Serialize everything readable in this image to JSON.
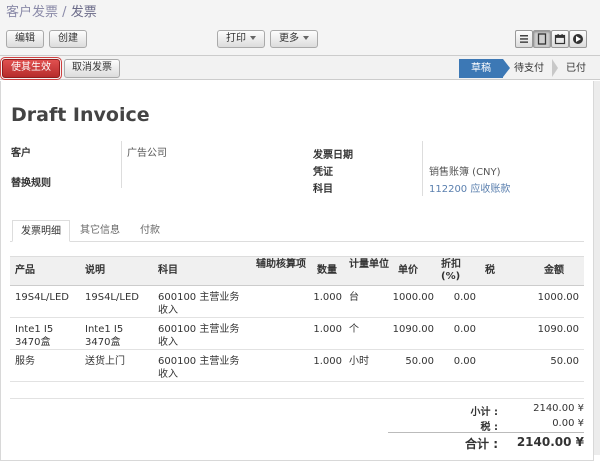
{
  "breadcrumb": {
    "parent": "客户发票",
    "separator": "/",
    "current": "发票"
  },
  "toolbar": {
    "edit": "编辑",
    "create": "创建",
    "print": "打印",
    "more": "更多"
  },
  "statusbar": {
    "validate": "使其生效",
    "cancel": "取消发票",
    "stages": [
      {
        "label": "草稿",
        "active": true
      },
      {
        "label": "待支付",
        "active": false
      },
      {
        "label": "已付",
        "active": false
      }
    ]
  },
  "invoice": {
    "title": "Draft Invoice",
    "customer_label": "客户",
    "customer_value": "广告公司",
    "fiscal_label": "替换规则",
    "date_label": "发票日期",
    "journal_label": "凭证",
    "journal_value": "销售账簿 (CNY)",
    "account_label": "科目",
    "account_value": "112200 应收账款"
  },
  "tabs": [
    "发票明细",
    "其它信息",
    "付款"
  ],
  "lines": {
    "columns": [
      "产品",
      "说明",
      "科目",
      "辅助核算项",
      "数量",
      "计量单位",
      "单价",
      "折扣(%)",
      "税",
      "金额"
    ],
    "rows": [
      {
        "product": "19S4L/LED",
        "desc": "19S4L/LED",
        "account": "600100 主营业务收入",
        "analytic": "",
        "qty": "1.000",
        "uom": "台",
        "price": "1000.00",
        "discount": "0.00",
        "tax": "",
        "amount": "1000.00"
      },
      {
        "product": "Inte1 I5 3470盒",
        "desc": "Inte1 I5 3470盒",
        "account": "600100 主营业务收入",
        "analytic": "",
        "qty": "1.000",
        "uom": "个",
        "price": "1090.00",
        "discount": "0.00",
        "tax": "",
        "amount": "1090.00"
      },
      {
        "product": "服务",
        "desc": "送货上门",
        "account": "600100 主营业务收入",
        "analytic": "",
        "qty": "1.000",
        "uom": "小时",
        "price": "50.00",
        "discount": "0.00",
        "tax": "",
        "amount": "50.00"
      }
    ]
  },
  "totals": {
    "subtotal_label": "小计 :",
    "subtotal": "2140.00 ¥",
    "tax_label": "税 :",
    "tax": "0.00 ¥",
    "total_label": "合计 :",
    "total": "2140.00 ¥"
  },
  "colors": {
    "active_stage": "#3c78b5",
    "validate_button": "#c83a3a",
    "link": "#5a7fae"
  }
}
